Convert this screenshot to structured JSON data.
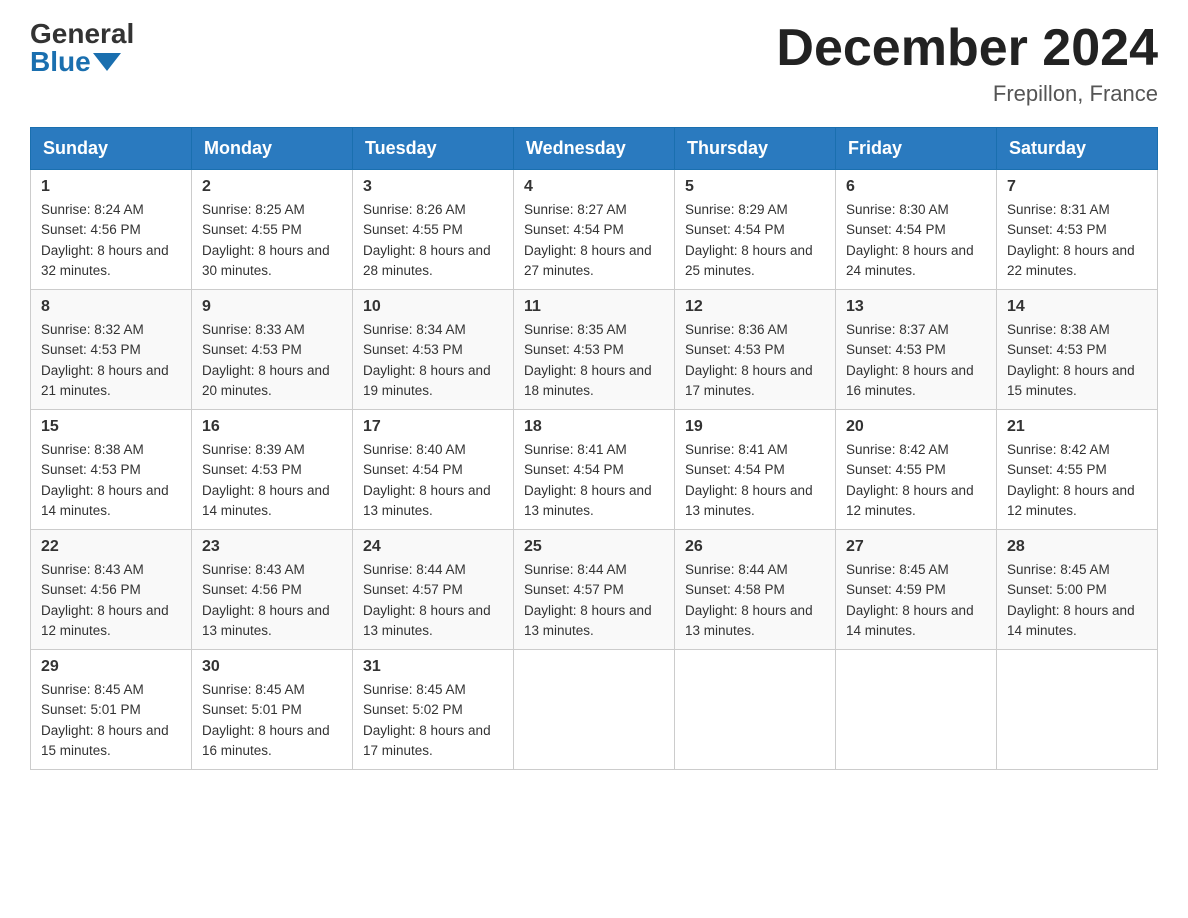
{
  "header": {
    "logo_general": "General",
    "logo_blue": "Blue",
    "month_year": "December 2024",
    "location": "Frepillon, France"
  },
  "weekdays": [
    "Sunday",
    "Monday",
    "Tuesday",
    "Wednesday",
    "Thursday",
    "Friday",
    "Saturday"
  ],
  "weeks": [
    [
      {
        "day": "1",
        "sunrise": "8:24 AM",
        "sunset": "4:56 PM",
        "daylight": "8 hours and 32 minutes."
      },
      {
        "day": "2",
        "sunrise": "8:25 AM",
        "sunset": "4:55 PM",
        "daylight": "8 hours and 30 minutes."
      },
      {
        "day": "3",
        "sunrise": "8:26 AM",
        "sunset": "4:55 PM",
        "daylight": "8 hours and 28 minutes."
      },
      {
        "day": "4",
        "sunrise": "8:27 AM",
        "sunset": "4:54 PM",
        "daylight": "8 hours and 27 minutes."
      },
      {
        "day": "5",
        "sunrise": "8:29 AM",
        "sunset": "4:54 PM",
        "daylight": "8 hours and 25 minutes."
      },
      {
        "day": "6",
        "sunrise": "8:30 AM",
        "sunset": "4:54 PM",
        "daylight": "8 hours and 24 minutes."
      },
      {
        "day": "7",
        "sunrise": "8:31 AM",
        "sunset": "4:53 PM",
        "daylight": "8 hours and 22 minutes."
      }
    ],
    [
      {
        "day": "8",
        "sunrise": "8:32 AM",
        "sunset": "4:53 PM",
        "daylight": "8 hours and 21 minutes."
      },
      {
        "day": "9",
        "sunrise": "8:33 AM",
        "sunset": "4:53 PM",
        "daylight": "8 hours and 20 minutes."
      },
      {
        "day": "10",
        "sunrise": "8:34 AM",
        "sunset": "4:53 PM",
        "daylight": "8 hours and 19 minutes."
      },
      {
        "day": "11",
        "sunrise": "8:35 AM",
        "sunset": "4:53 PM",
        "daylight": "8 hours and 18 minutes."
      },
      {
        "day": "12",
        "sunrise": "8:36 AM",
        "sunset": "4:53 PM",
        "daylight": "8 hours and 17 minutes."
      },
      {
        "day": "13",
        "sunrise": "8:37 AM",
        "sunset": "4:53 PM",
        "daylight": "8 hours and 16 minutes."
      },
      {
        "day": "14",
        "sunrise": "8:38 AM",
        "sunset": "4:53 PM",
        "daylight": "8 hours and 15 minutes."
      }
    ],
    [
      {
        "day": "15",
        "sunrise": "8:38 AM",
        "sunset": "4:53 PM",
        "daylight": "8 hours and 14 minutes."
      },
      {
        "day": "16",
        "sunrise": "8:39 AM",
        "sunset": "4:53 PM",
        "daylight": "8 hours and 14 minutes."
      },
      {
        "day": "17",
        "sunrise": "8:40 AM",
        "sunset": "4:54 PM",
        "daylight": "8 hours and 13 minutes."
      },
      {
        "day": "18",
        "sunrise": "8:41 AM",
        "sunset": "4:54 PM",
        "daylight": "8 hours and 13 minutes."
      },
      {
        "day": "19",
        "sunrise": "8:41 AM",
        "sunset": "4:54 PM",
        "daylight": "8 hours and 13 minutes."
      },
      {
        "day": "20",
        "sunrise": "8:42 AM",
        "sunset": "4:55 PM",
        "daylight": "8 hours and 12 minutes."
      },
      {
        "day": "21",
        "sunrise": "8:42 AM",
        "sunset": "4:55 PM",
        "daylight": "8 hours and 12 minutes."
      }
    ],
    [
      {
        "day": "22",
        "sunrise": "8:43 AM",
        "sunset": "4:56 PM",
        "daylight": "8 hours and 12 minutes."
      },
      {
        "day": "23",
        "sunrise": "8:43 AM",
        "sunset": "4:56 PM",
        "daylight": "8 hours and 13 minutes."
      },
      {
        "day": "24",
        "sunrise": "8:44 AM",
        "sunset": "4:57 PM",
        "daylight": "8 hours and 13 minutes."
      },
      {
        "day": "25",
        "sunrise": "8:44 AM",
        "sunset": "4:57 PM",
        "daylight": "8 hours and 13 minutes."
      },
      {
        "day": "26",
        "sunrise": "8:44 AM",
        "sunset": "4:58 PM",
        "daylight": "8 hours and 13 minutes."
      },
      {
        "day": "27",
        "sunrise": "8:45 AM",
        "sunset": "4:59 PM",
        "daylight": "8 hours and 14 minutes."
      },
      {
        "day": "28",
        "sunrise": "8:45 AM",
        "sunset": "5:00 PM",
        "daylight": "8 hours and 14 minutes."
      }
    ],
    [
      {
        "day": "29",
        "sunrise": "8:45 AM",
        "sunset": "5:01 PM",
        "daylight": "8 hours and 15 minutes."
      },
      {
        "day": "30",
        "sunrise": "8:45 AM",
        "sunset": "5:01 PM",
        "daylight": "8 hours and 16 minutes."
      },
      {
        "day": "31",
        "sunrise": "8:45 AM",
        "sunset": "5:02 PM",
        "daylight": "8 hours and 17 minutes."
      },
      null,
      null,
      null,
      null
    ]
  ],
  "labels": {
    "sunrise": "Sunrise:",
    "sunset": "Sunset:",
    "daylight": "Daylight:"
  }
}
